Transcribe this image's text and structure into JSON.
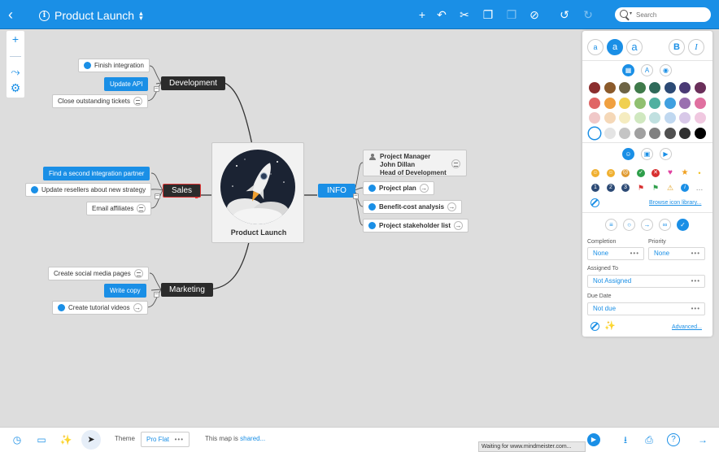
{
  "topbar": {
    "title": "Product Launch",
    "search_placeholder": "Search"
  },
  "map": {
    "central": "Product Launch",
    "development": {
      "label": "Development",
      "children": [
        "Finish integration",
        "Update API",
        "Close outstanding tickets"
      ]
    },
    "sales": {
      "label": "Sales",
      "children": [
        "Find a second integration partner",
        "Update resellers about new strategy",
        "Email affiliates"
      ]
    },
    "marketing": {
      "label": "Marketing",
      "children": [
        "Create social media pages",
        "Write copy",
        "Create tutorial videos"
      ]
    },
    "info": {
      "label": "INFO",
      "person_lines": [
        "Project Manager",
        "John Dillan",
        "Head of Development"
      ],
      "children": [
        "Project plan",
        "Benefit-cost analysis",
        "Project stakeholder list"
      ]
    }
  },
  "panel": {
    "text_a_small": "a",
    "text_a_medium": "a",
    "text_a_large": "a",
    "bold": "B",
    "italic": "I",
    "colors": [
      "#8b2e2e",
      "#8b5a2b",
      "#6e6445",
      "#3f7a4a",
      "#2f6a5a",
      "#2c4a75",
      "#4a3a75",
      "#6a2f5a",
      "#e06666",
      "#f0a040",
      "#f0d050",
      "#90c070",
      "#50b0a0",
      "#40a0e0",
      "#9a70b0",
      "#e070a0",
      "#f0c8c8",
      "#f5d8b8",
      "#f5ecc0",
      "#d0e8c0",
      "#c0e0e0",
      "#c0d8f0",
      "#d8c8e8",
      "#f0c8e0",
      "#ffffff",
      "#e4e4e4",
      "#c4c4c4",
      "#a0a0a0",
      "#808080",
      "#505050",
      "#303030",
      "#000000"
    ],
    "browse_icon_library": "Browse icon library...",
    "completion_label": "Completion",
    "completion_value": "None",
    "priority_label": "Priority",
    "priority_value": "None",
    "assigned_label": "Assigned To",
    "assigned_value": "Not Assigned",
    "due_label": "Due Date",
    "due_value": "Not due",
    "advanced": "Advanced..."
  },
  "bottombar": {
    "theme_label": "Theme",
    "theme_value": "Pro Flat",
    "shared_prefix": "This map is ",
    "shared_link": "shared...",
    "status": "Waiting for www.mindmeister.com..."
  }
}
